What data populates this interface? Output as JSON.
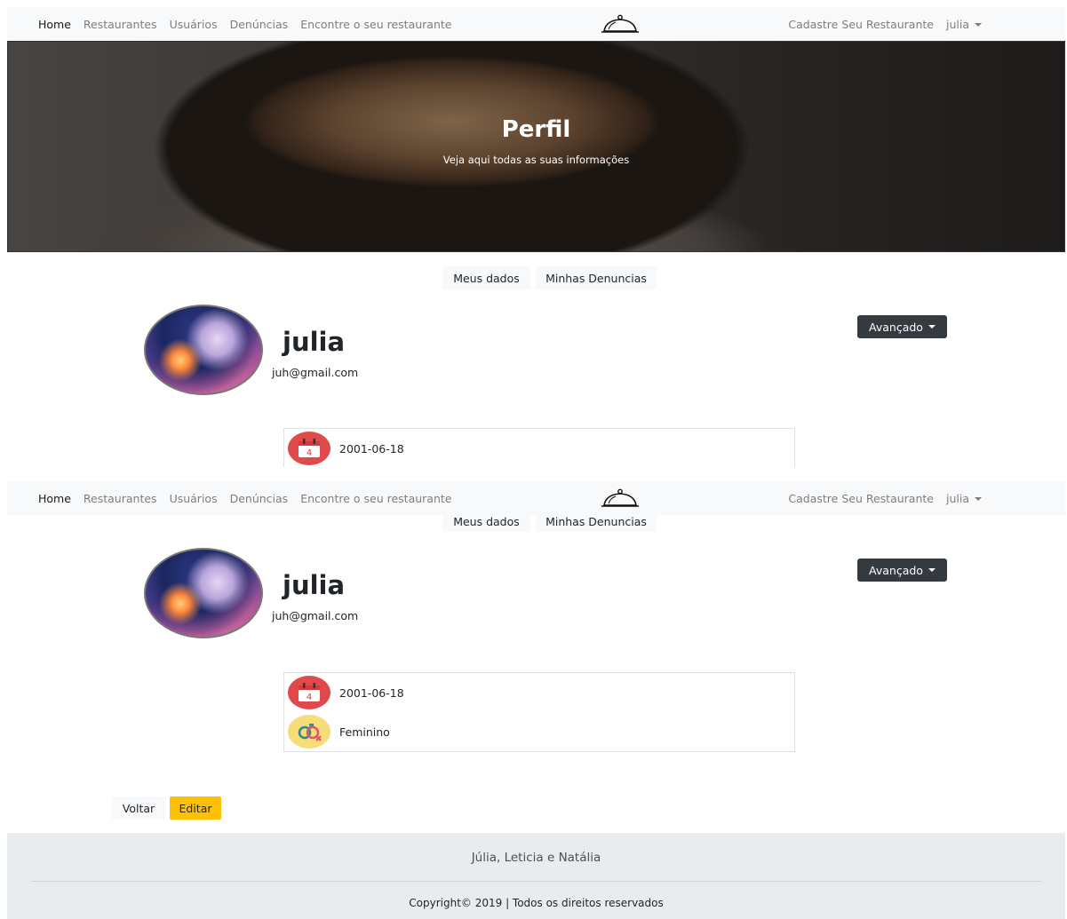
{
  "navbar": {
    "links": [
      "Home",
      "Restaurantes",
      "Usuários",
      "Denúncias",
      "Encontre o seu restaurante"
    ],
    "brand_icon": "cloche-icon",
    "register": "Cadastre Seu Restaurante",
    "user": "julia"
  },
  "hero": {
    "title": "Perfil",
    "subtitle": "Veja aqui todas as suas informações"
  },
  "tabs": {
    "my_data": "Meus dados",
    "my_reports": "Minhas Denuncias"
  },
  "profile": {
    "name": "julia",
    "email": "juh@gmail.com",
    "advanced_button": "Avançado",
    "birthdate": "2001-06-18",
    "calendar_day": "4",
    "gender": "Feminino"
  },
  "actions": {
    "back": "Voltar",
    "edit": "Editar"
  },
  "footer": {
    "names": "Júlia, Leticia e Natália",
    "copyright": "Copyright© 2019 | Todos os direitos reservados"
  },
  "colors": {
    "accent_warning": "#ffc107",
    "dark_button": "#343a40",
    "navbar_bg": "#f8f9fa",
    "footer_bg": "#e9ecef"
  }
}
